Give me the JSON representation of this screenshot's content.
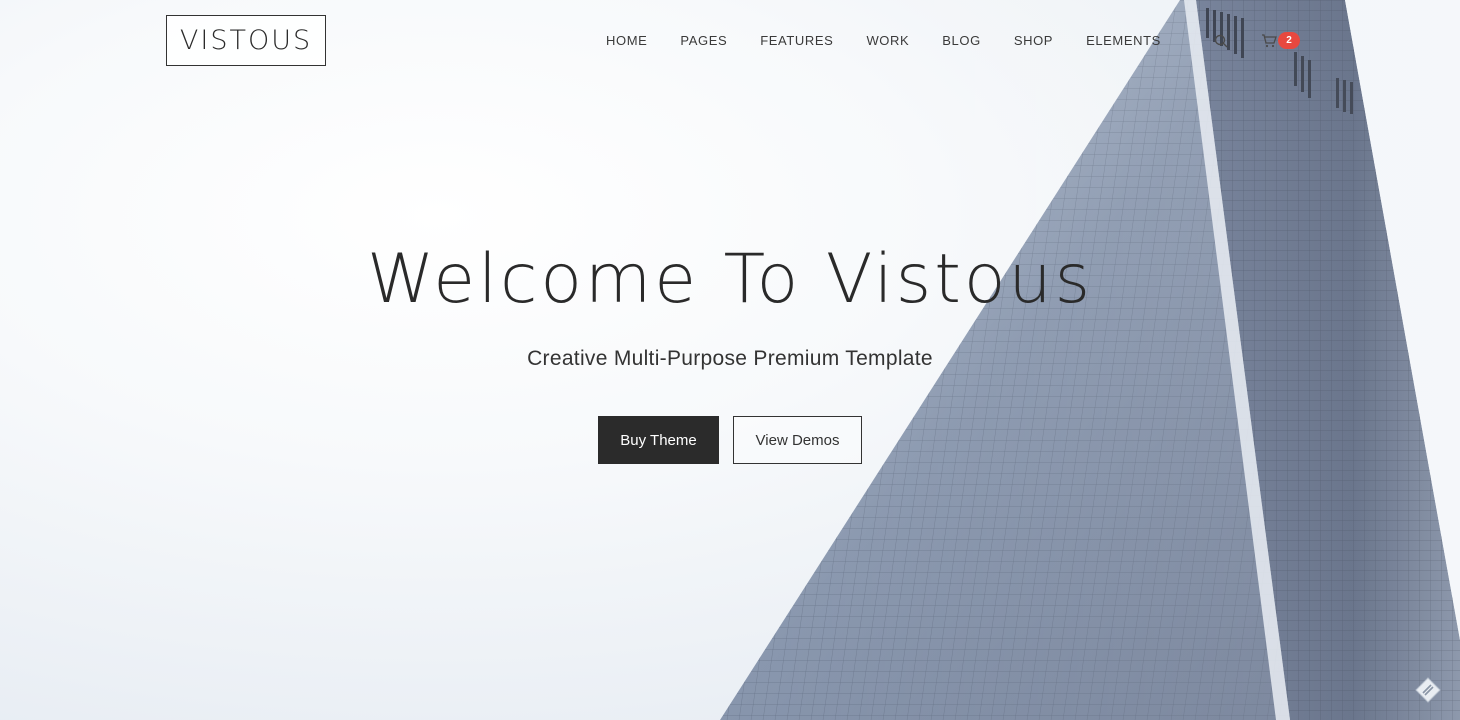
{
  "header": {
    "logo_text": "VISTOUS",
    "nav": [
      "HOME",
      "PAGES",
      "FEATURES",
      "WORK",
      "BLOG",
      "SHOP",
      "ELEMENTS"
    ],
    "cart_count": "2",
    "icons": [
      "search-icon",
      "cart-icon"
    ]
  },
  "hero": {
    "title": "Welcome To Vistous",
    "subtitle": "Creative Multi-Purpose Premium Template",
    "primary_button": "Buy Theme",
    "secondary_button": "View Demos"
  },
  "colors": {
    "badge": "#e8483f",
    "primary_button_bg": "#2b2b2b",
    "text": "#2b2b2b"
  }
}
